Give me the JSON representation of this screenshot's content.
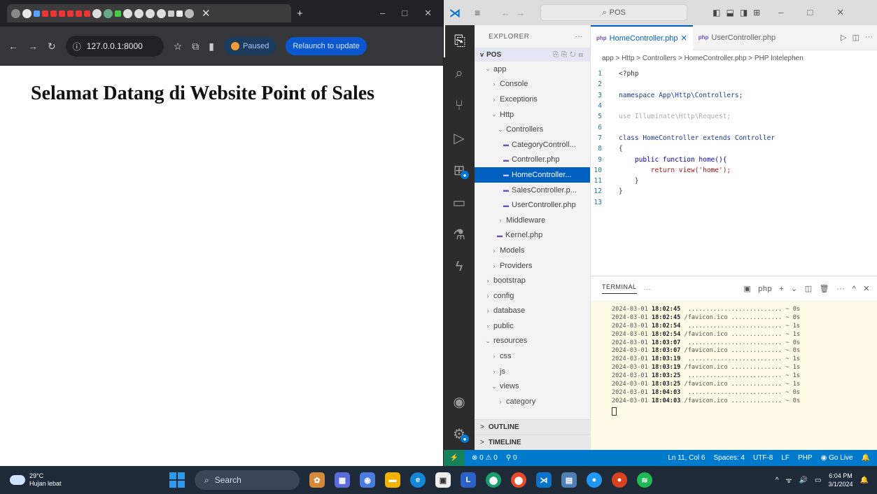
{
  "browser": {
    "url": "127.0.0.1:8000",
    "paused_label": "Paused",
    "relaunch_label": "Relaunch to update",
    "heading": "Selamat Datang di Website Point of Sales"
  },
  "vscode": {
    "search": "POS",
    "explorer_title": "EXPLORER",
    "root": "POS",
    "tree": [
      {
        "label": "app",
        "chev": "v",
        "indent": 0
      },
      {
        "label": "Console",
        "chev": ">",
        "indent": 1
      },
      {
        "label": "Exceptions",
        "chev": ">",
        "indent": 1
      },
      {
        "label": "Http",
        "chev": "v",
        "indent": 1
      },
      {
        "label": "Controllers",
        "chev": "v",
        "indent": 2
      },
      {
        "label": "CategoryControll...",
        "php": true,
        "indent": 3
      },
      {
        "label": "Controller.php",
        "php": true,
        "indent": 3
      },
      {
        "label": "HomeController...",
        "php": true,
        "indent": 3,
        "selected": true
      },
      {
        "label": "SalesController.p...",
        "php": true,
        "indent": 3
      },
      {
        "label": "UserController.php",
        "php": true,
        "indent": 3
      },
      {
        "label": "Middleware",
        "chev": ">",
        "indent": 2
      },
      {
        "label": "Kernel.php",
        "php": true,
        "indent": 2
      },
      {
        "label": "Models",
        "chev": ">",
        "indent": 1
      },
      {
        "label": "Providers",
        "chev": ">",
        "indent": 1
      },
      {
        "label": "bootstrap",
        "chev": ">",
        "indent": 0
      },
      {
        "label": "config",
        "chev": ">",
        "indent": 0
      },
      {
        "label": "database",
        "chev": ">",
        "indent": 0
      },
      {
        "label": "public",
        "chev": ">",
        "indent": 0
      },
      {
        "label": "resources",
        "chev": "v",
        "indent": 0
      },
      {
        "label": "css",
        "chev": ">",
        "indent": 1
      },
      {
        "label": "js",
        "chev": ">",
        "indent": 1
      },
      {
        "label": "views",
        "chev": "v",
        "indent": 1
      },
      {
        "label": "category",
        "chev": ">",
        "indent": 2
      }
    ],
    "outline_label": "OUTLINE",
    "timeline_label": "TIMELINE",
    "tabs": [
      "HomeController.php",
      "UserController.php"
    ],
    "breadcrumb": "app > Http > Controllers > HomeController.php > PHP Intelephen",
    "code": [
      "<?php",
      "",
      "namespace App\\Http\\Controllers;",
      "",
      "use Illuminate\\Http\\Request;",
      "",
      "class HomeController extends Controller",
      "{",
      "    public function home(){",
      "        return view('home');",
      "    }",
      "}",
      ""
    ],
    "terminal_title": "TERMINAL",
    "terminal_shell": "php",
    "terminal_lines": [
      {
        "date": "2024-03-01",
        "time": "18:02:45",
        "path": "",
        "dur": "~ 0s"
      },
      {
        "date": "2024-03-01",
        "time": "18:02:45",
        "path": "/favicon.ico",
        "dur": "~ 0s"
      },
      {
        "date": "2024-03-01",
        "time": "18:02:54",
        "path": "",
        "dur": "~ 1s"
      },
      {
        "date": "2024-03-01",
        "time": "18:02:54",
        "path": "/favicon.ico",
        "dur": "~ 1s"
      },
      {
        "date": "2024-03-01",
        "time": "18:03:07",
        "path": "",
        "dur": "~ 0s"
      },
      {
        "date": "2024-03-01",
        "time": "18:03:07",
        "path": "/favicon.ico",
        "dur": "~ 0s"
      },
      {
        "date": "2024-03-01",
        "time": "18:03:19",
        "path": "",
        "dur": "~ 1s"
      },
      {
        "date": "2024-03-01",
        "time": "18:03:19",
        "path": "/favicon.ico",
        "dur": "~ 1s"
      },
      {
        "date": "2024-03-01",
        "time": "18:03:25",
        "path": "",
        "dur": "~ 1s"
      },
      {
        "date": "2024-03-01",
        "time": "18:03:25",
        "path": "/favicon.ico",
        "dur": "~ 1s"
      },
      {
        "date": "2024-03-01",
        "time": "18:04:03",
        "path": "",
        "dur": "~ 0s"
      },
      {
        "date": "2024-03-01",
        "time": "18:04:03",
        "path": "/favicon.ico",
        "dur": "~ 0s"
      }
    ],
    "status": {
      "problems": "0 ⚠ 0",
      "ports": "0",
      "position": "Ln 11, Col 6",
      "spaces": "Spaces: 4",
      "encoding": "UTF-8",
      "eol": "LF",
      "language": "PHP",
      "golive": "Go Live"
    }
  },
  "taskbar": {
    "temp": "29°C",
    "weather": "Hujan lebat",
    "search": "Search",
    "time": "6:04 PM",
    "date": "3/1/2024"
  }
}
